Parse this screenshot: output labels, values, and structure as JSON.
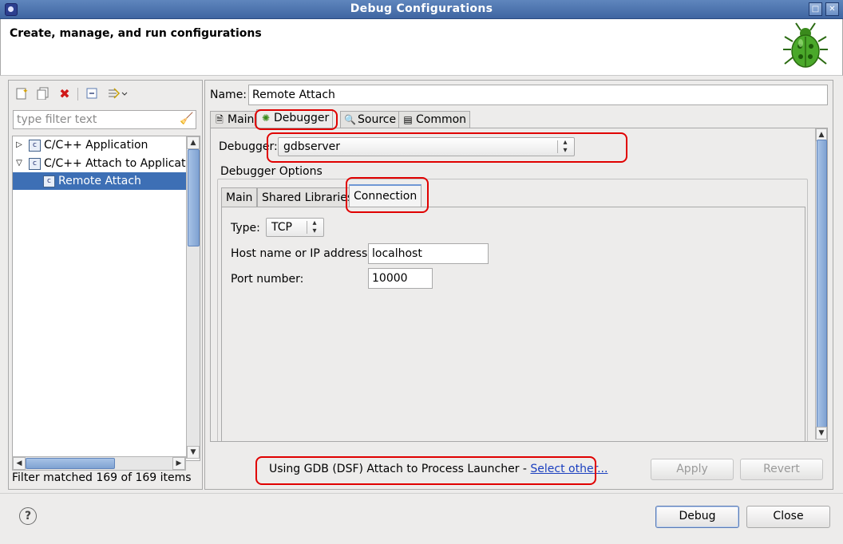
{
  "window": {
    "title": "Debug Configurations",
    "controls": [
      "restore-icon",
      "close-icon"
    ]
  },
  "header": {
    "title": "Create, manage, and run configurations",
    "image": "bug-icon"
  },
  "left": {
    "toolbar": [
      "new-config-icon",
      "duplicate-icon",
      "delete-icon",
      "collapse-all-icon",
      "filter-icon"
    ],
    "filter_placeholder": "type filter text",
    "tree": [
      {
        "label": "C/C++ Application",
        "expanded": false,
        "selected": false,
        "icon": "c-config-icon"
      },
      {
        "label": "C/C++ Attach to Applicatio",
        "expanded": true,
        "selected": false,
        "icon": "c-config-icon"
      },
      {
        "label": "Remote Attach",
        "expanded": false,
        "selected": true,
        "icon": "c-config-icon"
      }
    ],
    "status": "Filter matched 169 of 169 items"
  },
  "right": {
    "name_label": "Name:",
    "name_value": "Remote Attach",
    "tabs": [
      {
        "label": "Main",
        "icon": "main-tab-icon",
        "active": false
      },
      {
        "label": "Debugger",
        "icon": "debugger-bug-icon",
        "active": true
      },
      {
        "label": "Source",
        "icon": "source-icon",
        "active": false
      },
      {
        "label": "Common",
        "icon": "common-icon",
        "active": false
      }
    ],
    "debugger_label": "Debugger:",
    "debugger_value": "gdbserver",
    "options_title": "Debugger Options",
    "inner_tabs": [
      {
        "label": "Main",
        "active": false
      },
      {
        "label": "Shared Libraries",
        "active": false
      },
      {
        "label": "Connection",
        "active": true
      }
    ],
    "connection": {
      "type_label": "Type:",
      "type_value": "TCP",
      "host_label": "Host name or IP address:",
      "host_value": "localhost",
      "port_label": "Port number:",
      "port_value": "10000"
    },
    "launcher_text": "Using GDB (DSF) Attach to Process Launcher - ",
    "launcher_link": "Select other...",
    "apply": "Apply",
    "revert": "Revert"
  },
  "footer": {
    "debug": "Debug",
    "close": "Close",
    "help": "?"
  },
  "colors": {
    "highlight": "#e00000",
    "selection": "#3d6fb5",
    "titlebar": "#4a70aa",
    "link": "#1a3fbf"
  }
}
